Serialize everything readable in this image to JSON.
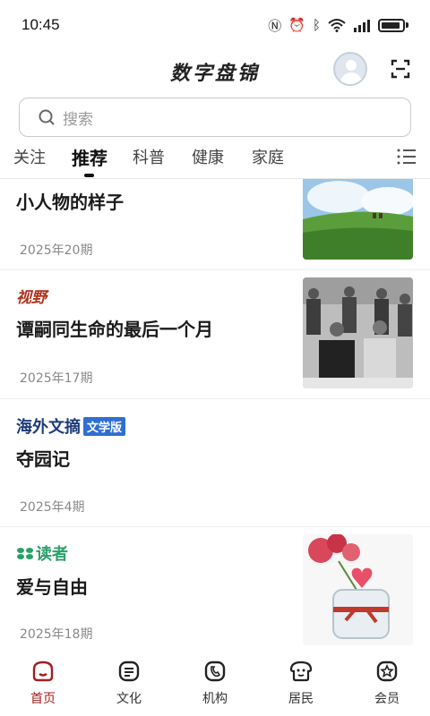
{
  "status_bar": {
    "time": "10:45",
    "icons": [
      "nfc-icon",
      "alarm-icon",
      "bluetooth-icon",
      "wifi-icon",
      "signal-icon",
      "battery-icon"
    ]
  },
  "header": {
    "title": "数字盘锦"
  },
  "search": {
    "placeholder": "搜索"
  },
  "tabs": [
    {
      "label": "关注"
    },
    {
      "label": "推荐"
    },
    {
      "label": "科普"
    },
    {
      "label": "健康"
    },
    {
      "label": "家庭"
    }
  ],
  "feed": [
    {
      "title": "小人物的样子",
      "issue": "2025年20期",
      "source": ""
    },
    {
      "title": "谭嗣同生命的最后一个月",
      "issue": "2025年17期",
      "source": "视野"
    },
    {
      "title": "夺园记",
      "issue": "2025年4期",
      "source": "海外文摘",
      "source_badge": "文学版"
    },
    {
      "title": "爱与自由",
      "issue": "2025年18期",
      "source": "读者"
    }
  ],
  "bottom_nav": [
    {
      "label": "首页"
    },
    {
      "label": "文化"
    },
    {
      "label": "机构"
    },
    {
      "label": "居民"
    },
    {
      "label": "会员"
    }
  ],
  "colors": {
    "accent": "#a21e1e",
    "source_red": "#b0301c",
    "source_blue": "#1f3c7a",
    "source_green": "#2aa06a"
  }
}
